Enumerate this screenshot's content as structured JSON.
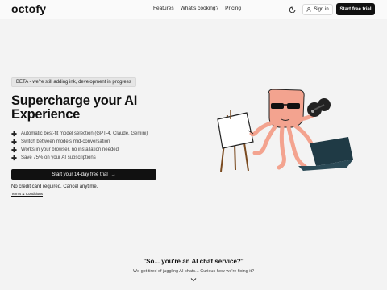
{
  "header": {
    "logo": "octofy",
    "nav": [
      "Features",
      "What's cooking?",
      "Pricing"
    ],
    "theme_icon": "moon-icon",
    "signin_label": "Sign in",
    "cta_label": "Start free trial"
  },
  "hero": {
    "beta_badge": "BETA - we're still adding ink, development in progress",
    "title": "Supercharge your AI Experience",
    "features": [
      "Automatic best-fit model selection (GPT-4, Claude, Gemini)",
      "Switch between models mid-conversation",
      "Works in your browser, no installation needed",
      "Save 75% on your AI subscriptions"
    ],
    "cta_label": "Start your 14-day free trial",
    "note": "No credit card required. Cancel anytime.",
    "terms_label": "Terms & Conditions"
  },
  "section": {
    "question": "\"So... you're an AI chat service?\"",
    "subtitle": "We got tired of juggling AI chats... Curious how we're fixing it?"
  },
  "colors": {
    "accent": "#111111",
    "octopus": "#f3a38f",
    "laptop": "#1f3a45",
    "background": "#f3f3f3"
  }
}
